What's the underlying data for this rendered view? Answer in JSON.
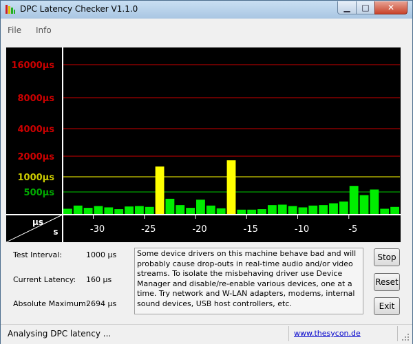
{
  "window": {
    "title": "DPC Latency Checker V1.1.0"
  },
  "menu": {
    "items": [
      "File",
      "Info"
    ]
  },
  "colors": {
    "chart_bg": "#000000",
    "normal_bar": "#00ee00",
    "warn_bar": "#ffff00",
    "high_line": "#cc0000",
    "mid_line": "#ffff00",
    "low_line": "#00cc00",
    "label_red": "#cc0000",
    "label_yellow": "#cccc00",
    "label_green": "#00aa00"
  },
  "chart_data": {
    "type": "bar",
    "y_levels": [
      {
        "label": "16000µs",
        "value": 16000,
        "color_key": "high"
      },
      {
        "label": "8000µs",
        "value": 8000,
        "color_key": "high"
      },
      {
        "label": "4000µs",
        "value": 4000,
        "color_key": "high"
      },
      {
        "label": "2000µs",
        "value": 2000,
        "color_key": "high"
      },
      {
        "label": "1000µs",
        "value": 1000,
        "color_key": "mid"
      },
      {
        "label": "500µs",
        "value": 500,
        "color_key": "low"
      }
    ],
    "corner_labels": {
      "y_unit": "µs",
      "x_unit": "s"
    },
    "x_ticks": [
      {
        "label": "-30",
        "value": -30
      },
      {
        "label": "-25",
        "value": -25
      },
      {
        "label": "-20",
        "value": -20
      },
      {
        "label": "-15",
        "value": -15
      },
      {
        "label": "-10",
        "value": -10
      },
      {
        "label": "-5",
        "value": -5
      }
    ],
    "values_us": [
      130,
      200,
      150,
      190,
      160,
      120,
      180,
      190,
      170,
      1500,
      350,
      210,
      150,
      330,
      200,
      140,
      1800,
      110,
      110,
      120,
      210,
      220,
      190,
      160,
      200,
      210,
      250,
      290,
      700,
      430,
      580,
      130,
      170
    ],
    "warn_threshold_us": 1000
  },
  "info": {
    "test_interval_label": "Test Interval:",
    "test_interval_value": "1000 µs",
    "current_latency_label": "Current Latency:",
    "current_latency_value": "160 µs",
    "absolute_max_label": "Absolute Maximum:",
    "absolute_max_value": "2694 µs"
  },
  "description": "Some device drivers on this machine behave bad and will probably cause drop-outs in real-time audio and/or video streams. To isolate the misbehaving driver use Device Manager and disable/re-enable various devices, one at a time. Try network and W-LAN adapters, modems, internal sound devices, USB host controllers, etc.",
  "buttons": {
    "stop": "Stop",
    "reset": "Reset",
    "exit": "Exit"
  },
  "status": {
    "text": "Analysing DPC latency ...",
    "link": "www.thesycon.de"
  }
}
